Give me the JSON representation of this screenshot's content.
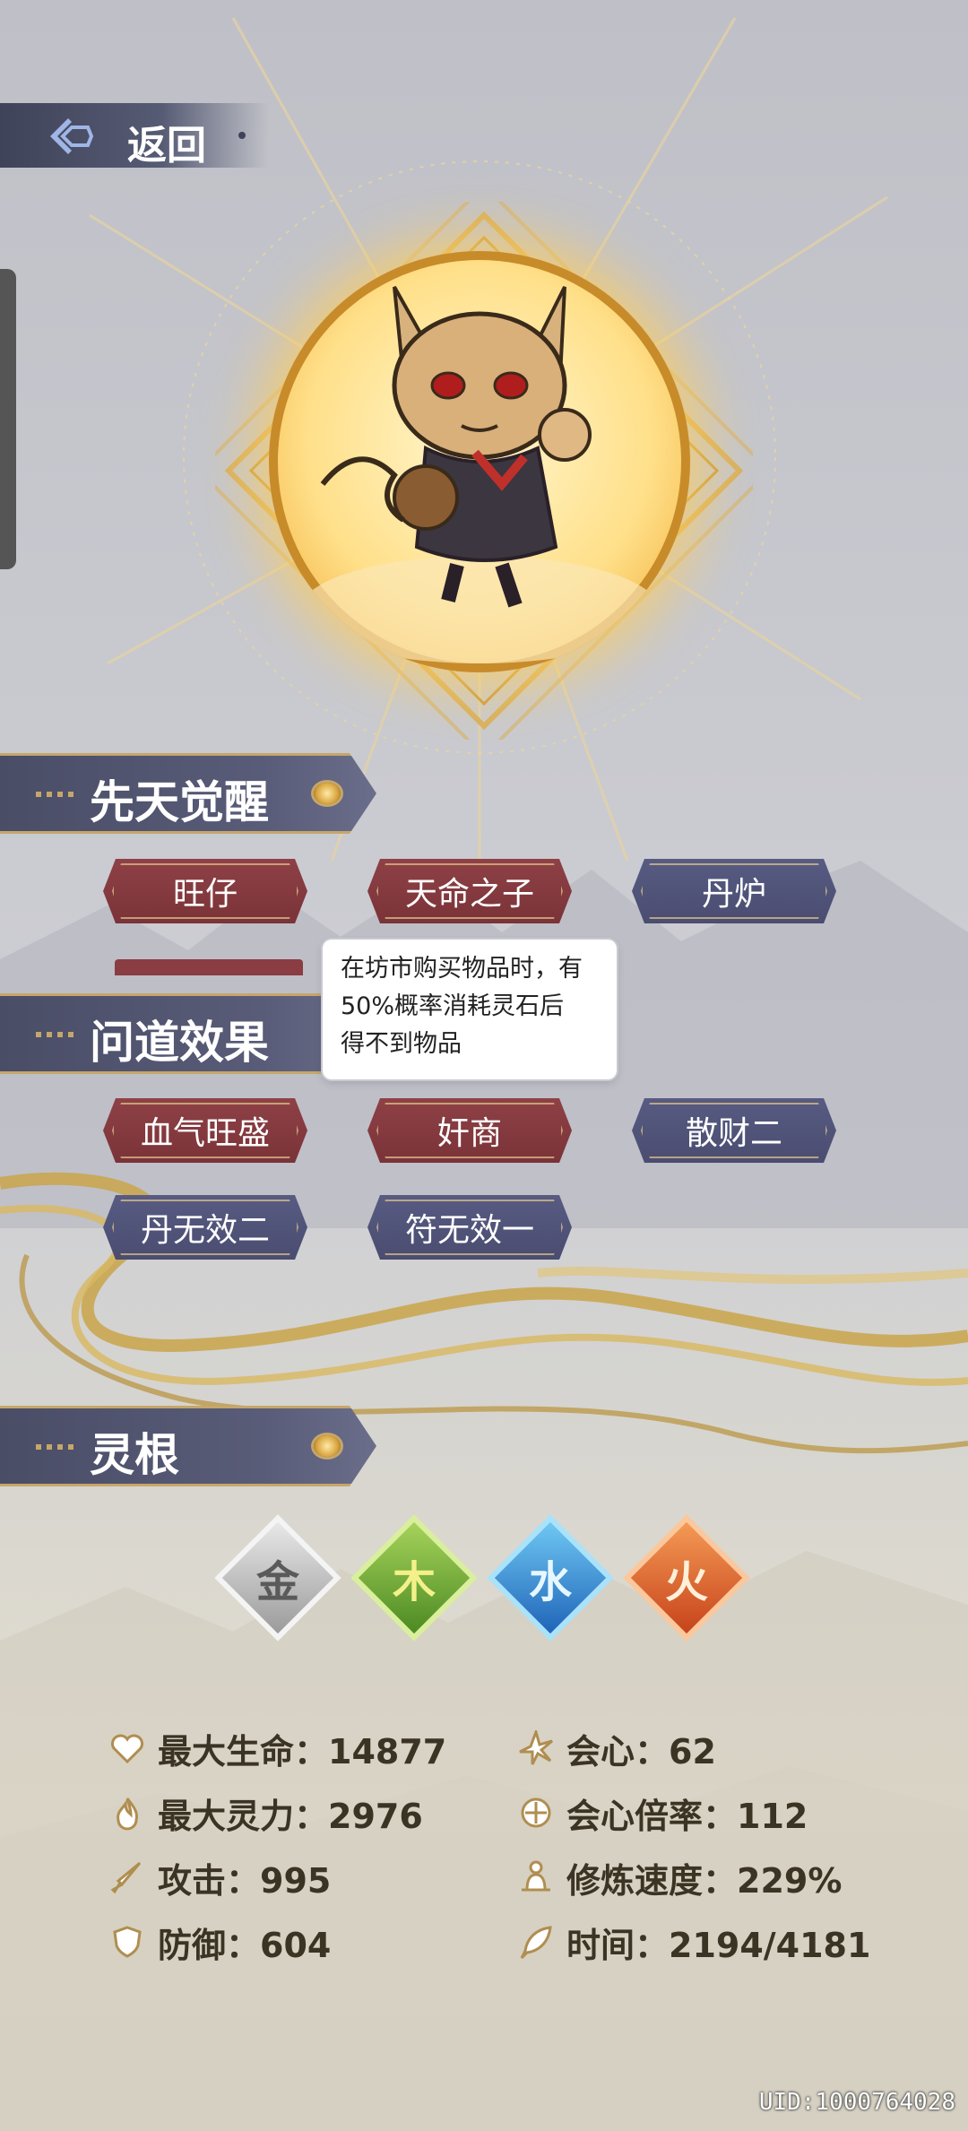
{
  "nav": {
    "back_label": "返回"
  },
  "sections": {
    "innate": {
      "title": "先天觉醒",
      "tags": [
        {
          "label": "旺仔",
          "color": "red"
        },
        {
          "label": "天命之子",
          "color": "red"
        },
        {
          "label": "丹炉",
          "color": "blue"
        }
      ]
    },
    "dao": {
      "title": "问道效果",
      "tags": [
        {
          "label": "血气旺盛",
          "color": "red"
        },
        {
          "label": "奸商",
          "color": "red"
        },
        {
          "label": "散财二",
          "color": "blue"
        },
        {
          "label": "丹无效二",
          "color": "blue"
        },
        {
          "label": "符无效一",
          "color": "blue"
        }
      ]
    },
    "roots": {
      "title": "灵根",
      "elements": [
        {
          "glyph": "金",
          "icon": "metal-root-icon",
          "color": "#b9b9b9"
        },
        {
          "glyph": "木",
          "icon": "wood-root-icon",
          "color": "#7cb342"
        },
        {
          "glyph": "水",
          "icon": "water-root-icon",
          "color": "#2f8fd6"
        },
        {
          "glyph": "火",
          "icon": "fire-root-icon",
          "color": "#e0662a"
        }
      ]
    }
  },
  "tooltip": {
    "lines": [
      "在坊市购买物品时，有",
      "50%概率消耗灵石后",
      "得不到物品"
    ]
  },
  "stats": {
    "max_hp": {
      "label": "最大生命：14877",
      "icon": "heart-icon"
    },
    "max_mp": {
      "label": "最大灵力：2976",
      "icon": "spirit-flame-icon"
    },
    "attack": {
      "label": "攻击：995",
      "icon": "sword-icon"
    },
    "defense": {
      "label": "防御：604",
      "icon": "shield-icon"
    },
    "crit": {
      "label": "会心：62",
      "icon": "burst-icon"
    },
    "crit_mult": {
      "label": "会心倍率：112",
      "icon": "crosshair-icon"
    },
    "cultivation_speed": {
      "label": "修炼速度：229%",
      "icon": "meditation-icon"
    },
    "time": {
      "label": "时间：2194/4181",
      "icon": "feather-icon"
    }
  },
  "uid": "UID:1000764028",
  "colors": {
    "gold": "#c6a66a",
    "tag_red": "#8a3d42",
    "tag_blue": "#50537a",
    "header": "#50536c"
  }
}
